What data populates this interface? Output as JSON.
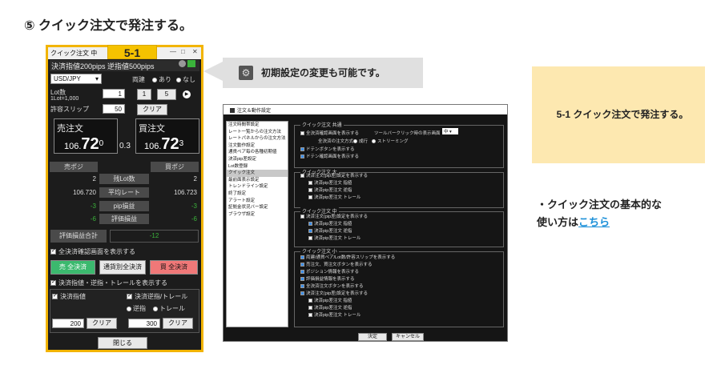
{
  "heading": "⑤ クイック注文で発注する。",
  "quick_panel": {
    "badge": "5-1",
    "title": "クイック注文 中",
    "subtitle": "決済指値200pips 逆指値500pips",
    "currency": "USD/JPY",
    "ryodate_label": "両建",
    "ryodate_on": "あり",
    "ryodate_off": "なし",
    "lot_label": "Lot数",
    "lot_sub": "1Lot=1,000",
    "lot_value": "1",
    "lot_btn1": "1",
    "lot_btn5": "5",
    "slip_label": "許容スリップ",
    "slip_value": "50",
    "clear": "クリア",
    "sell_label": "売注文",
    "buy_label": "買注文",
    "sell_price_small": "106.",
    "sell_price_big": "72",
    "sell_price_sup": "0",
    "spread": "0.3",
    "buy_price_small": "106.",
    "buy_price_big": "72",
    "buy_price_sup": "3",
    "sell_pos": "売ポジ",
    "buy_pos": "買ポジ",
    "rows": [
      {
        "left": "2",
        "label": "残Lot数",
        "right": "2"
      },
      {
        "left": "106.720",
        "label": "平均レート",
        "right": "106.723"
      },
      {
        "left": "-3",
        "label": "pip損益",
        "right": "-3"
      },
      {
        "left": "-6",
        "label": "評価損益",
        "right": "-6"
      }
    ],
    "total_label": "評価損益合計",
    "total_value": "-12",
    "confirm_label": "全決済確認画面を表示する",
    "btn_sell_all": "売 全決済",
    "btn_pair_all": "通貨別全決済",
    "btn_buy_all": "買 全決済",
    "show_limits_label": "決済指値・逆指・トレールを表示する",
    "limit_label": "決済指値",
    "stop_label": "決済逆指/トレール",
    "stop_opt1": "逆指",
    "stop_opt2": "トレール",
    "limit_value": "200",
    "stop_value": "300",
    "close": "閉じる"
  },
  "callout": {
    "text": "初期設定の変更も可能です。"
  },
  "settings": {
    "title": "注文＆動作設定",
    "list": [
      "注文時間帯設定",
      "レート一覧からの注文方法",
      "レートパネルからの注文方法",
      "注文動作設定",
      "通貨ペア毎の各種初期値",
      "決済pip差設定",
      "Lot数登録",
      "クイック注文",
      "最前面表示設定",
      "トレンドライン設定",
      "終了設定",
      "アラート設定",
      "証拠金状況バー設定",
      "ブラウザ設定"
    ],
    "active_index": 7,
    "g1_title": "クイック注文 共通",
    "g1_lines": [
      "全決済確認画面を表示する",
      "ツールバークリック時の表示画面",
      "全決済の注文方式",
      "成行",
      "ストリーミング",
      "ドテンボタンを表示する",
      "ドテン確認画面を表示する"
    ],
    "g1_select": "中",
    "g2_title": "クイック注文 大",
    "g2_lines": [
      "決済注文(pip差)設定を表示する",
      "決済pip差注文 指値",
      "決済pip差注文 逆指",
      "決済pip差注文 トレール"
    ],
    "g3_title": "クイック注文 中",
    "g3_lines": [
      "決済注文(pip差)設定を表示する",
      "決済pip差注文 指値",
      "決済pip差注文 逆指",
      "決済pip差注文 トレール"
    ],
    "g4_title": "クイック注文 小",
    "g4_lines": [
      "両建/通貨ペア/Lot数/許容スリップを表示する",
      "売注文、買注文ボタンを表示する",
      "ポジション情報を表示する",
      "評価損益情報を表示する",
      "全決済注文ボタンを表示する",
      "決済注文(pip差)設定を表示する",
      "決済pip差注文 指値",
      "決済pip差注文 逆指",
      "決済pip差注文 トレール"
    ],
    "ok": "決定",
    "cancel": "キャンセル"
  },
  "info_box": "5-1 クイック注文で発注する。",
  "note_line1": "・クイック注文の基本的な",
  "note_line2": "使い方は",
  "note_link": "こちら"
}
